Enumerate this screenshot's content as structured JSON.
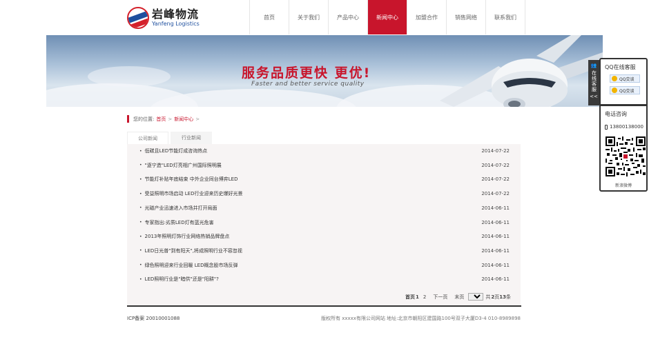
{
  "header": {
    "logo_cn": "岩峰物流",
    "logo_en": "Yanfeng Logistics",
    "nav": [
      {
        "label": "首页",
        "active": false
      },
      {
        "label": "关于我们",
        "active": false
      },
      {
        "label": "产品中心",
        "active": false
      },
      {
        "label": "新闻中心",
        "active": true
      },
      {
        "label": "加盟合作",
        "active": false
      },
      {
        "label": "销售网络",
        "active": false
      },
      {
        "label": "联系我们",
        "active": false
      }
    ]
  },
  "banner": {
    "title": "服务品质更快 更优!",
    "subtitle": "Faster and better service quality"
  },
  "breadcrumb": {
    "prefix": "您的位置:",
    "home": "首页",
    "sep1": ">",
    "current": "新闻中心",
    "sep2": ">"
  },
  "tabs": [
    {
      "label": "公司新闻",
      "active": true
    },
    {
      "label": "行业新闻",
      "active": false
    }
  ],
  "news": [
    {
      "title": "低碳且LED节能灯成咨询热点",
      "date": "2014-07-22"
    },
    {
      "title": "\"逐宁造\"LED灯亮相广州国际照明展",
      "date": "2014-07-22"
    },
    {
      "title": "节能灯补贴年底结束 中外企业同台博弈LED",
      "date": "2014-07-22"
    },
    {
      "title": "受益照明市场启动 LED行业迎来历史爆好光景",
      "date": "2014-07-22"
    },
    {
      "title": "光磁产业迅速进入市场并打开局面",
      "date": "2014-06-11"
    },
    {
      "title": "专家指出:劣质LED灯有蓝光危害",
      "date": "2014-06-11"
    },
    {
      "title": "2013年照明灯饰行业网络热销品牌盘点",
      "date": "2014-06-11"
    },
    {
      "title": "LED日光普\"到有阳天\",将成照明行业不容忽视",
      "date": "2014-06-11"
    },
    {
      "title": "绿色照明迎来行业回暖 LED概念股市场反弹",
      "date": "2014-06-11"
    },
    {
      "title": "LED照明行业是\"暗供\"还是\"阳耕\"?",
      "date": "2014-06-11"
    }
  ],
  "pager": {
    "first": "首页",
    "current": "1",
    "page2": "2",
    "next": "下一页",
    "last": "末页",
    "select_value": "1",
    "total_prefix": "共",
    "total_pages": "2",
    "pages_word": "页",
    "total_items": "13",
    "items_word": "条"
  },
  "footer": {
    "icp": "ICP备案 20010001088",
    "copyright": "版权所有 xxxxx有限公司网站 地址:北京市朝阳区建国路100号双子大厦D3-4 010-8989898"
  },
  "side": {
    "tab_text": "在线客服",
    "collapse": "<<",
    "qq_title": "QQ在线客服",
    "qq_buttons": [
      "QQ交谈",
      "QQ交谈"
    ],
    "phone_title": "电话咨询",
    "phone": "13800138000",
    "qr_caption": "新浪微博"
  },
  "colors": {
    "accent": "#c8152c",
    "brand_blue": "#1e4f9e"
  }
}
